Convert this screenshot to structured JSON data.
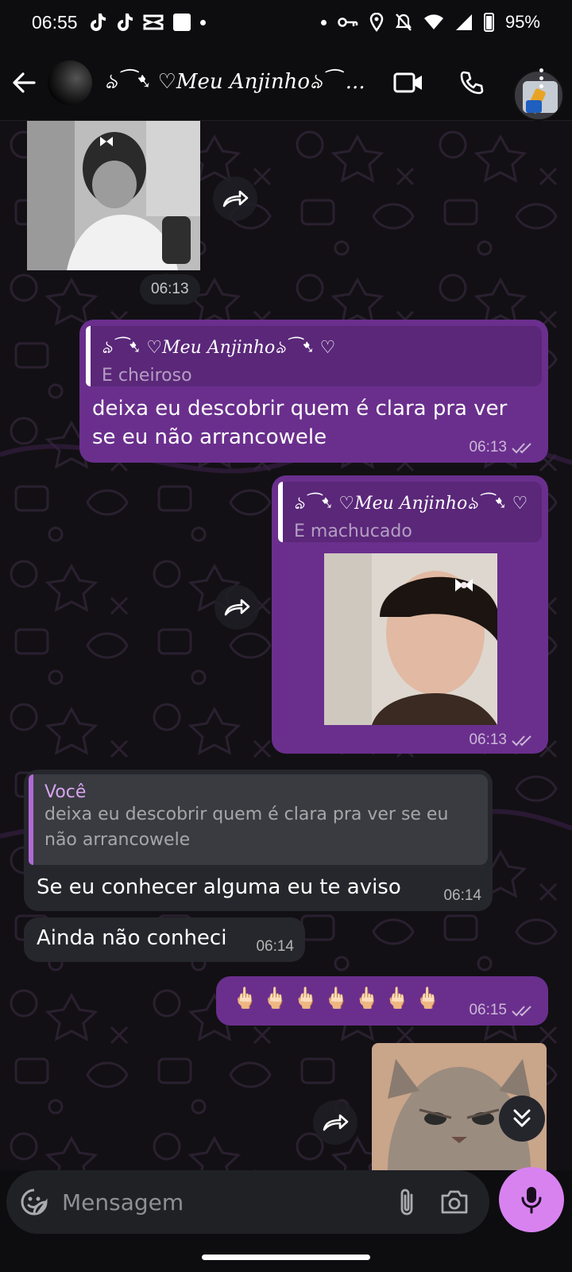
{
  "status_bar": {
    "time": "06:55",
    "battery": "95%",
    "left_icons": [
      "tiktok-icon",
      "tiktok-icon",
      "capcut-icon",
      "square-app-icon",
      "dot"
    ],
    "right_icons": [
      "dot",
      "key-icon",
      "location-icon",
      "mute-bell-icon",
      "wifi-icon",
      "signal-icon",
      "battery-icon"
    ]
  },
  "header": {
    "contact_name": "ঌ︎⁀➷ ♡Meu Anjinhoঌ︎⁀ ...",
    "icons": [
      "back-arrow-icon",
      "video-call-icon",
      "phone-call-icon",
      "menu-icon"
    ]
  },
  "messages": [
    {
      "type": "photo",
      "direction": "in",
      "time": "06:13",
      "description_icon": "photo-bw-person"
    },
    {
      "type": "reply_text",
      "direction": "out",
      "quote_author": "ঌ︎⁀➷ ♡Meu Anjinhoঌ︎⁀➷ ♡",
      "quote_text": "E cheiroso",
      "text": "deixa eu descobrir quem é clara pra ver se eu não arrancowele",
      "time": "06:13"
    },
    {
      "type": "reply_photo",
      "direction": "out",
      "quote_author": "ঌ︎⁀➷ ♡Meu Anjinhoঌ︎⁀➷ ♡",
      "quote_text": "E machucado",
      "time": "06:13"
    },
    {
      "type": "reply_text",
      "direction": "in",
      "quote_author": "Você",
      "quote_text": "deixa eu descobrir quem é clara pra ver se eu não arrancowele",
      "text": "Se eu conhecer alguma eu te aviso",
      "time": "06:14"
    },
    {
      "type": "text",
      "direction": "in",
      "text": "Ainda não conheci",
      "time": "06:14"
    },
    {
      "type": "emoji",
      "direction": "out",
      "text": "🖕🏻🖕🏻🖕🏻🖕🏻🖕🏻🖕🏻🖕🏻",
      "time": "06:15"
    },
    {
      "type": "photo",
      "direction": "out",
      "description_icon": "photo-cat"
    }
  ],
  "input": {
    "placeholder": "Mensagem"
  },
  "colors": {
    "outgoing_bubble": "#6a2f8d",
    "incoming_bubble": "#26272c",
    "accent": "#d882f0",
    "background": "#0d0d0f"
  }
}
